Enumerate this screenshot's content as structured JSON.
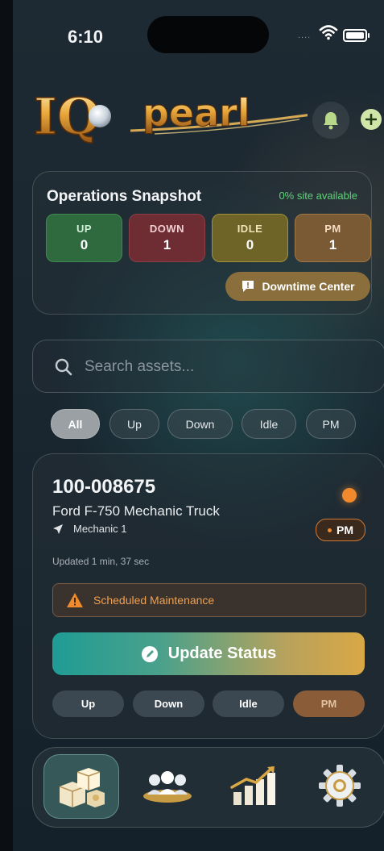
{
  "status_bar": {
    "time": "6:10",
    "signal": "...."
  },
  "header": {
    "brand": "IQpearl",
    "brand_main": "IQ",
    "brand_tail": "pearl"
  },
  "snapshot": {
    "title": "Operations Snapshot",
    "availability": "0% site available",
    "tiles": [
      {
        "label": "UP",
        "value": "0"
      },
      {
        "label": "DOWN",
        "value": "1"
      },
      {
        "label": "IDLE",
        "value": "0"
      },
      {
        "label": "PM",
        "value": "1"
      }
    ],
    "downtime_button": "Downtime Center"
  },
  "search": {
    "placeholder": "Search assets..."
  },
  "filters": [
    "All",
    "Up",
    "Down",
    "Idle",
    "PM"
  ],
  "asset": {
    "id": "100-008675",
    "name": "Ford F-750 Mechanic Truck",
    "location": "Mechanic 1",
    "badge": "PM",
    "updated": "Updated 1 min, 37 sec",
    "alert": "Scheduled Maintenance",
    "update_button": "Update Status",
    "status_buttons": [
      "Up",
      "Down",
      "Idle",
      "PM"
    ]
  },
  "colors": {
    "accent_teal": "#1f9c94",
    "accent_gold": "#d9a845",
    "pm_orange": "#f08a2c",
    "available_green": "#5fd27a"
  },
  "tabs": [
    {
      "icon": "assets-cubes-icon",
      "active": true
    },
    {
      "icon": "team-icon",
      "active": false
    },
    {
      "icon": "analytics-chart-icon",
      "active": false
    },
    {
      "icon": "settings-gear-icon",
      "active": false
    }
  ]
}
